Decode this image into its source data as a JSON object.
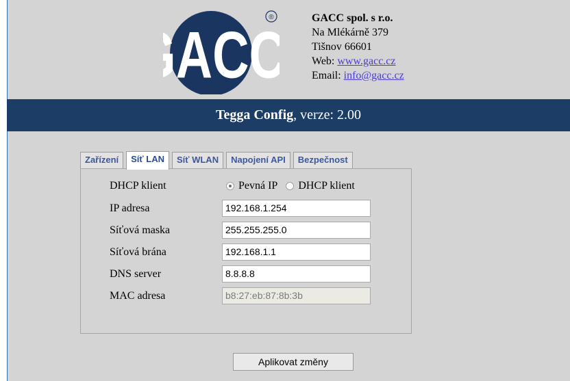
{
  "company": {
    "name": "GACC spol. s r.o.",
    "street": "Na Mlékárně 379",
    "city": "Tišnov 66601",
    "web_label": "Web: ",
    "web_link": "www.gacc.cz",
    "email_label": "Email: ",
    "email_link": "info@gacc.cz",
    "logo_text": "GACC",
    "logo_mark": "®"
  },
  "banner": {
    "app_name": "Tegga Config",
    "version": ", verze: 2.00"
  },
  "tabs": [
    {
      "label": "Zařízení",
      "active": false
    },
    {
      "label": "Síť LAN",
      "active": true
    },
    {
      "label": "Síť WLAN",
      "active": false
    },
    {
      "label": "Napojení API",
      "active": false
    },
    {
      "label": "Bezpečnost",
      "active": false
    }
  ],
  "form": {
    "dhcp_label": "DHCP klient",
    "radio_static": "Pevná IP",
    "radio_dhcp": "DHCP klient",
    "selected": "static",
    "ip_label": "IP adresa",
    "ip_value": "192.168.1.254",
    "mask_label": "Síťová maska",
    "mask_value": "255.255.255.0",
    "gateway_label": "Síťová brána",
    "gateway_value": "192.168.1.1",
    "dns_label": "DNS server",
    "dns_value": "8.8.8.8",
    "mac_label": "MAC adresa",
    "mac_value": "b8:27:eb:87:8b:3b"
  },
  "actions": {
    "apply_label": "Aplikovat změny"
  },
  "colors": {
    "banner_bg": "#1c3d66",
    "logo": "#1a3660",
    "link": "#4a3bd1"
  }
}
